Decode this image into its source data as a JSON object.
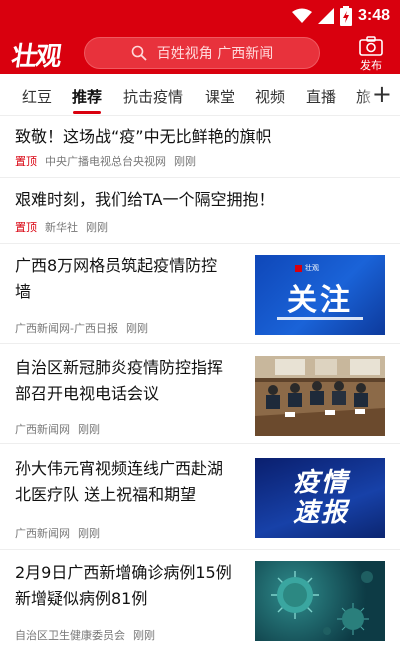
{
  "status_bar": {
    "time": "3:48"
  },
  "app_bar": {
    "logo": "壮观",
    "search_placeholder": "百姓视角 广西新闻",
    "publish_label": "发布"
  },
  "tabs": [
    {
      "label": "红豆"
    },
    {
      "label": "推荐"
    },
    {
      "label": "抗击疫情"
    },
    {
      "label": "课堂"
    },
    {
      "label": "视频"
    },
    {
      "label": "直播"
    },
    {
      "label": "旅"
    }
  ],
  "add_tab": "+",
  "news": [
    {
      "title": "致敬！这场战“疫”中无比鲜艳的旗帜",
      "pin": "置顶",
      "source": "中央广播电视总台央视网",
      "time": "刚刚"
    },
    {
      "title": "艰难时刻，我们给TA一个隔空拥抱！",
      "pin": "置顶",
      "source": "新华社",
      "time": "刚刚"
    },
    {
      "title_line1": "广西8万网格员筑起疫情防控",
      "title_line2": "墙",
      "source": "广西新闻网-广西日报",
      "time": "刚刚",
      "thumb_text": "关注",
      "thumb_badge": "壮观"
    },
    {
      "title_line1": "自治区新冠肺炎疫情防控指挥",
      "title_line2": "部召开电视电话会议",
      "source": "广西新闻网",
      "time": "刚刚"
    },
    {
      "title_line1": "孙大伟元宵视频连线广西赴湖",
      "title_line2": "北医疗队 送上祝福和期望",
      "source": "广西新闻网",
      "time": "刚刚",
      "thumb_text_1": "疫情",
      "thumb_text_2": "速报"
    },
    {
      "title_line1": "2月9日广西新增确诊病例15例",
      "title_line2": "新增疑似病例81例",
      "source": "自治区卫生健康委员会",
      "time": "刚刚"
    }
  ]
}
